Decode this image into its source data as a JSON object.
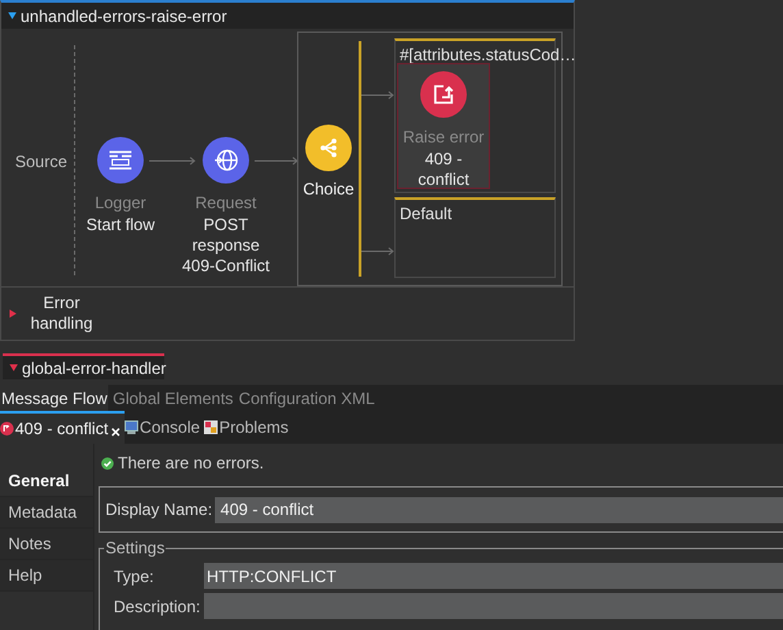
{
  "flow": {
    "title": "unhandled-errors-raise-error",
    "expanded": true,
    "source_label": "Source",
    "nodes": [
      {
        "kind": "logger",
        "type_label": "Logger",
        "label": "Start flow"
      },
      {
        "kind": "request",
        "type_label": "Request",
        "label": "POST response 409-Conflict"
      }
    ],
    "choice": {
      "label": "Choice",
      "routes": [
        {
          "condition": "#[attributes.statusCod…",
          "nodes": [
            {
              "kind": "raise_error",
              "type_label": "Raise error",
              "label": "409 - conflict",
              "selected": true
            }
          ]
        },
        {
          "condition": "Default"
        }
      ]
    },
    "error_handling": {
      "label": "Error handling",
      "expanded": false
    }
  },
  "handler": {
    "title": "global-error-handler",
    "expanded": true
  },
  "editor_tabs": [
    {
      "label": "Message Flow",
      "selected": true
    },
    {
      "label": "Global Elements",
      "selected": false
    },
    {
      "label": "Configuration XML",
      "selected": false
    }
  ],
  "view_tabs": [
    {
      "kind": "properties",
      "label": "409 - conflict",
      "selected": true,
      "closable": true
    },
    {
      "kind": "console",
      "label": "Console",
      "selected": false
    },
    {
      "kind": "problems",
      "label": "Problems",
      "selected": false
    }
  ],
  "properties": {
    "sections": [
      {
        "label": "General",
        "selected": true
      },
      {
        "label": "Metadata",
        "selected": false
      },
      {
        "label": "Notes",
        "selected": false
      },
      {
        "label": "Help",
        "selected": false
      }
    ],
    "status": "There are no errors.",
    "display_name": {
      "label": "Display Name:",
      "value": "409 - conflict"
    },
    "settings": {
      "title": "Settings",
      "fields": [
        {
          "label": "Type:",
          "value": "HTTP:CONFLICT"
        },
        {
          "label": "Description:"
        }
      ]
    }
  }
}
